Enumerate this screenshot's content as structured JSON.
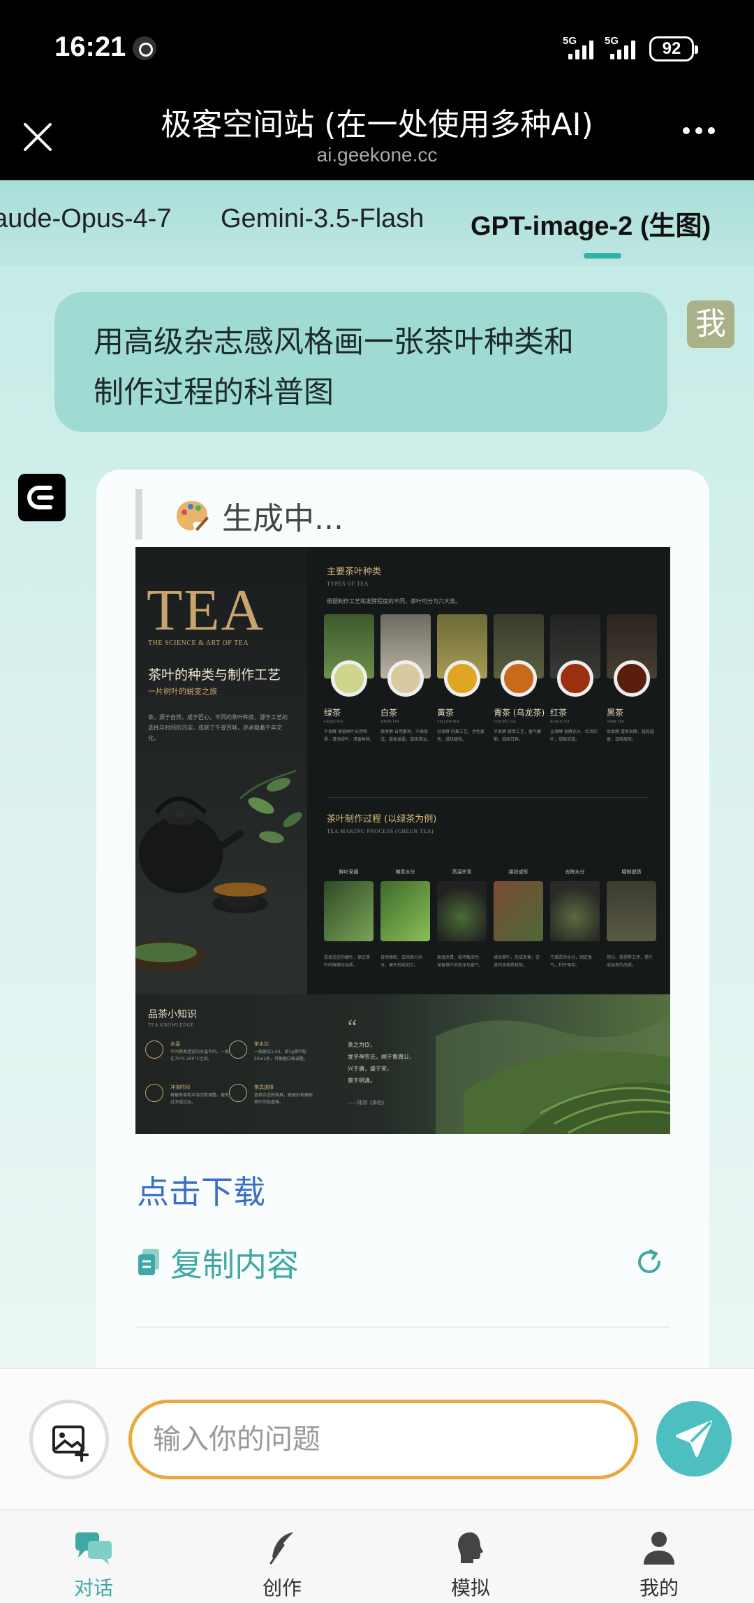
{
  "status": {
    "time": "16:21",
    "network": [
      "5G",
      "5G"
    ],
    "battery": "92"
  },
  "header": {
    "title": "极客空间站 (在一处使用多种AI)",
    "url": "ai.geekone.cc"
  },
  "tabs": {
    "items": [
      "aude-Opus-4-7",
      "Gemini-3.5-Flash",
      "GPT-image-2 (生图)"
    ],
    "active_index": 2
  },
  "user_message": {
    "line1": "用高级杂志感风格画一张茶叶种类和",
    "line2": "制作过程的科普图",
    "avatar": "我"
  },
  "bot": {
    "status": "生成中...",
    "download": "点击下载",
    "copy": "复制内容"
  },
  "poster": {
    "tea": "TEA",
    "tagline": "THE SCIENCE & ART OF TEA",
    "headline": "茶叶的种类与制作工艺",
    "subheadline": "一片树叶的蜕变之旅",
    "intro": "茶，源于自然，成于匠心。不同的茶叶种类，源于工艺的选择与时间的沉淀，成就了千姿百味，亦承载着千年文化。",
    "types_title": "主要茶叶种类",
    "types_sub": "TYPES OF TEA",
    "types_note": "根据制作工艺和发酵程度的不同，茶叶可分为六大类。",
    "types": [
      {
        "name": "绿茶",
        "en": "GREEN TEA",
        "desc": "不发酵 保留鲜叶天然物质，清汤绿叶，清香鲜爽。"
      },
      {
        "name": "白茶",
        "en": "WHITE TEA",
        "desc": "微发酵 自然萎凋，干燥而成，毫香显露，滋味清淡。"
      },
      {
        "name": "黄茶",
        "en": "YELLOW TEA",
        "desc": "轻发酵 闷黄工艺，汤色黄亮，滋味醇和。"
      },
      {
        "name": "青茶 (乌龙茶)",
        "en": "OOLONG TEA",
        "desc": "半发酵 做青工艺，香气馥郁，滋味甘爽。"
      },
      {
        "name": "红茶",
        "en": "BLACK TEA",
        "desc": "全发酵 发酵充分，红汤红叶，甜醇浓厚。"
      },
      {
        "name": "黑茶",
        "en": "DARK TEA",
        "desc": "后发酵 渥堆发酵，越陈越香，滋味醇厚。"
      }
    ],
    "process_title": "茶叶制作过程 (以绿茶为例)",
    "process_sub": "TEA MAKING PROCESS (GREEN TEA)",
    "process": [
      {
        "name": "鲜叶采摘",
        "desc": "选择适宜的嫩叶，保证茶叶的鲜嫩与品质。"
      },
      {
        "name": "摊青水分",
        "desc": "自然摊晾，去除部分水分，便于后续加工。"
      },
      {
        "name": "高温杀青",
        "desc": "高温杀青，破坏酶活性，保留茶叶的色泽与香气。"
      },
      {
        "name": "揉捻成形",
        "desc": "揉捻茶叶，形成条索，促进内含物质释放。"
      },
      {
        "name": "去除水分",
        "desc": "干燥去除水分，固定香气，利于保存。"
      },
      {
        "name": "精制提质",
        "desc": "筛分、拣剔等工序，提升成品茶的品质。"
      }
    ],
    "knowledge_title": "品茶小知识",
    "knowledge_sub": "TEA KNOWLEDGE",
    "knowledge": [
      {
        "head": "水温",
        "text": "不同茶类适宜的水温不同，一般在70°C-100°C之间。"
      },
      {
        "head": "茶水比",
        "text": "一般建议1:50，即1g茶叶配50mL水，可根据口味调整。"
      },
      {
        "head": "冲泡时间",
        "text": "根据茶类和冲泡次数调整，避免过浓或过淡。"
      },
      {
        "head": "茶具选择",
        "text": "选择合适的茶具，能更好地展现茶叶的色香味。"
      }
    ],
    "quote_mark": "“",
    "quote": [
      "茶之为饮，",
      "发乎神农氏，闻于鲁周公，",
      "兴于唐，盛于宋，",
      "普于明清。"
    ],
    "quote_author": "——陆羽《茶经》"
  },
  "input": {
    "placeholder": "输入你的问题"
  },
  "nav": {
    "items": [
      "对话",
      "创作",
      "模拟",
      "我的"
    ],
    "active_index": 0
  },
  "colors": {
    "accent": "#3fa8a4",
    "input_border": "#eba93b",
    "send": "#4dbfc0",
    "link": "#3b6fc2"
  }
}
